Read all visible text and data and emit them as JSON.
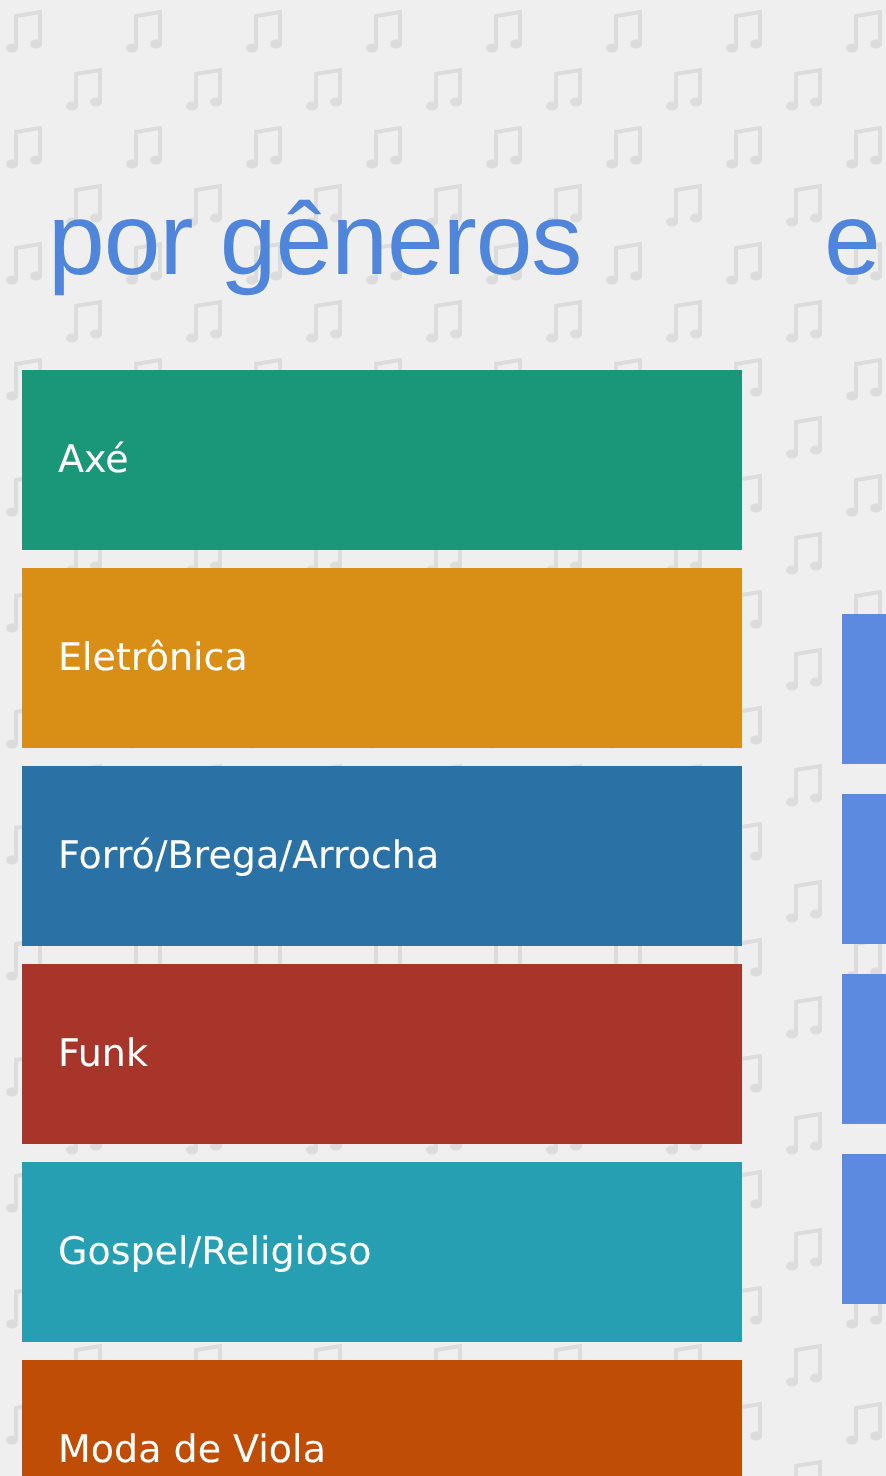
{
  "sections": [
    {
      "heading": "por gêneros",
      "tiles": [
        {
          "label": "Axé",
          "color": "#1a9678"
        },
        {
          "label": "Eletrônica",
          "color": "#d98e16"
        },
        {
          "label": "Forró/Brega/Arrocha",
          "color": "#2a72a6"
        },
        {
          "label": "Funk",
          "color": "#a8352a"
        },
        {
          "label": "Gospel/Religioso",
          "color": "#279fb2"
        },
        {
          "label": "Moda de Viola",
          "color": "#c04d06"
        }
      ]
    },
    {
      "heading": "e",
      "tiles": [
        {
          "color": "#5b8ae0"
        },
        {
          "color": "#5b8ae0"
        },
        {
          "color": "#5b8ae0"
        },
        {
          "color": "#5b8ae0"
        }
      ]
    }
  ]
}
